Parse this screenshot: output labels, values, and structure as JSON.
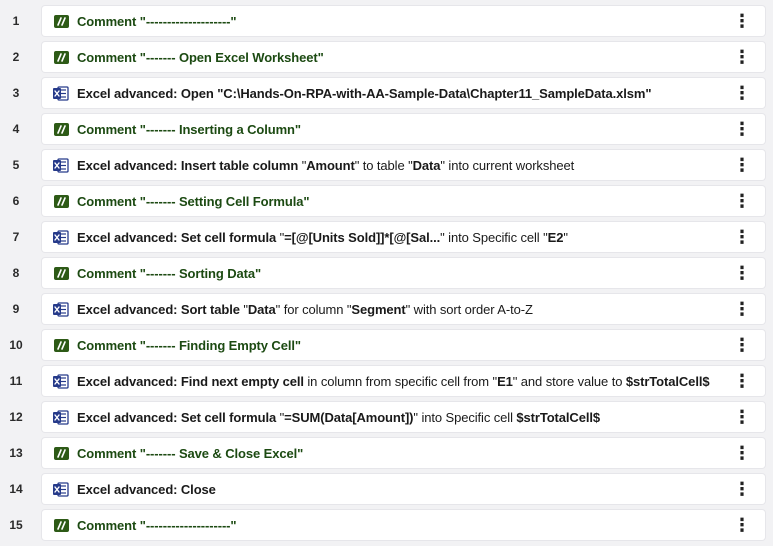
{
  "steps": [
    {
      "num": "1",
      "type": "comment",
      "parts": [
        {
          "t": "Comment ",
          "b": true
        },
        {
          "t": "\"--------------------\"",
          "b": true
        }
      ]
    },
    {
      "num": "2",
      "type": "comment",
      "parts": [
        {
          "t": "Comment ",
          "b": true
        },
        {
          "t": "\"------- Open Excel Worksheet\"",
          "b": true
        }
      ]
    },
    {
      "num": "3",
      "type": "excel",
      "parts": [
        {
          "t": "Excel advanced: Open ",
          "b": true
        },
        {
          "t": "\"C:\\Hands-On-RPA-with-AA-Sample-Data\\Chapter11_SampleData.xlsm\"",
          "b": true
        }
      ]
    },
    {
      "num": "4",
      "type": "comment",
      "parts": [
        {
          "t": "Comment ",
          "b": true
        },
        {
          "t": "\"------- Inserting a Column\"",
          "b": true
        }
      ]
    },
    {
      "num": "5",
      "type": "excel",
      "parts": [
        {
          "t": "Excel advanced: Insert table column ",
          "b": true
        },
        {
          "t": "\"",
          "b": false
        },
        {
          "t": "Amount",
          "b": true
        },
        {
          "t": "\" to table \"",
          "b": false
        },
        {
          "t": "Data",
          "b": true
        },
        {
          "t": "\" into current worksheet",
          "b": false
        }
      ]
    },
    {
      "num": "6",
      "type": "comment",
      "parts": [
        {
          "t": "Comment ",
          "b": true
        },
        {
          "t": "\"------- Setting Cell Formula\"",
          "b": true
        }
      ]
    },
    {
      "num": "7",
      "type": "excel",
      "parts": [
        {
          "t": "Excel advanced: Set cell formula ",
          "b": true
        },
        {
          "t": "\"",
          "b": false
        },
        {
          "t": "=[@[Units Sold]]*[@[Sal...",
          "b": true
        },
        {
          "t": "\" into Specific cell \"",
          "b": false
        },
        {
          "t": "E2",
          "b": true
        },
        {
          "t": "\"",
          "b": false
        }
      ]
    },
    {
      "num": "8",
      "type": "comment",
      "parts": [
        {
          "t": "Comment ",
          "b": true
        },
        {
          "t": "\"------- Sorting Data\"",
          "b": true
        }
      ]
    },
    {
      "num": "9",
      "type": "excel",
      "parts": [
        {
          "t": "Excel advanced: Sort table ",
          "b": true
        },
        {
          "t": "\"",
          "b": false
        },
        {
          "t": "Data",
          "b": true
        },
        {
          "t": "\" for column \"",
          "b": false
        },
        {
          "t": "Segment",
          "b": true
        },
        {
          "t": "\" with sort order A-to-Z",
          "b": false
        }
      ]
    },
    {
      "num": "10",
      "type": "comment",
      "parts": [
        {
          "t": "Comment ",
          "b": true
        },
        {
          "t": "\"------- Finding Empty Cell\"",
          "b": true
        }
      ]
    },
    {
      "num": "11",
      "type": "excel",
      "parts": [
        {
          "t": "Excel advanced: Find next empty cell ",
          "b": true
        },
        {
          "t": "in column from specific cell from \"",
          "b": false
        },
        {
          "t": "E1",
          "b": true
        },
        {
          "t": "\" and store value to ",
          "b": false
        },
        {
          "t": "$strTotalCell$",
          "b": true
        }
      ]
    },
    {
      "num": "12",
      "type": "excel",
      "parts": [
        {
          "t": "Excel advanced: Set cell formula ",
          "b": true
        },
        {
          "t": "\"",
          "b": false
        },
        {
          "t": "=SUM(Data[Amount])",
          "b": true
        },
        {
          "t": "\" into Specific cell ",
          "b": false
        },
        {
          "t": "$strTotalCell$",
          "b": true
        }
      ]
    },
    {
      "num": "13",
      "type": "comment",
      "parts": [
        {
          "t": "Comment ",
          "b": true
        },
        {
          "t": "\"------- Save & Close Excel\"",
          "b": true
        }
      ]
    },
    {
      "num": "14",
      "type": "excel",
      "parts": [
        {
          "t": "Excel advanced: Close",
          "b": true
        }
      ]
    },
    {
      "num": "15",
      "type": "comment",
      "parts": [
        {
          "t": "Comment ",
          "b": true
        },
        {
          "t": "\"--------------------\"",
          "b": true
        }
      ]
    }
  ],
  "icons": {
    "comment": "comment-icon",
    "excel": "excel-advanced-icon"
  },
  "menu_glyph": "⋮",
  "colors": {
    "comment_icon": "#2d5a16",
    "excel_icon": "#263a8a",
    "comment_text": "#1c4a12",
    "background": "#f2f2f4"
  }
}
